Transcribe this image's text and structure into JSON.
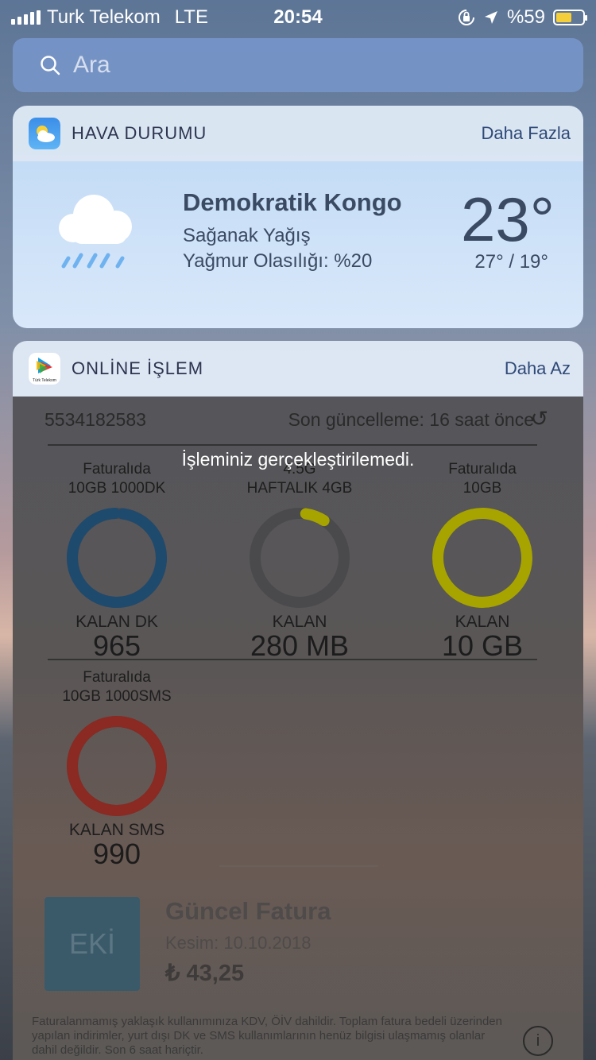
{
  "status_bar": {
    "carrier": "Turk Telekom",
    "network": "LTE",
    "time": "20:54",
    "battery_percent": "%59",
    "battery_level": 0.59
  },
  "search": {
    "placeholder": "Ara"
  },
  "weather_widget": {
    "title": "HAVA DURUMU",
    "more_label": "Daha Fazla",
    "city": "Demokratik Kongo",
    "condition": "Sağanak Yağış",
    "rain_chance": "Yağmur Olasılığı: %20",
    "temperature": "23°",
    "high_low": "27° / 19°"
  },
  "online_widget": {
    "title": "ONLİNE İŞLEM",
    "less_label": "Daha Az",
    "icon_caption": "Türk Telekom",
    "phone_number": "5534182583",
    "last_updated": "Son güncelleme: 16 saat önce",
    "error_message": "İşleminiz gerçekleştirilemedi.",
    "usages": [
      {
        "label_line1": "Faturalıda",
        "label_line2": "10GB 1000DK",
        "remaining_label": "KALAN DK",
        "value": "965",
        "color": "#1e4a6e",
        "fraction": 0.97
      },
      {
        "label_line1": "4.5G",
        "label_line2": "HAFTALIK 4GB",
        "remaining_label": "KALAN",
        "value": "280 MB",
        "color": "#a7a400",
        "fraction": 0.07
      },
      {
        "label_line1": "Faturalıda",
        "label_line2": "10GB",
        "remaining_label": "KALAN",
        "value": "10 GB",
        "color": "#a7a400",
        "fraction": 1.0
      },
      {
        "label_line1": "Faturalıda",
        "label_line2": "10GB 1000SMS",
        "remaining_label": "KALAN SMS",
        "value": "990",
        "color": "#8a2a22",
        "fraction": 0.99
      }
    ],
    "bill": {
      "month": "EKİ",
      "title": "Güncel Fatura",
      "date": "Kesim: 10.10.2018",
      "amount": "₺ 43,25"
    },
    "footnote": "Faturalanmamış yaklaşık kullanımınıza KDV, ÖİV dahildir. Toplam fatura bedeli üzerinden yapılan indirimler, yurt dışı DK ve SMS kullanımlarının henüz bilgisi ulaşmamış olanlar dahil değildir. Son 6 saat hariçtir."
  }
}
